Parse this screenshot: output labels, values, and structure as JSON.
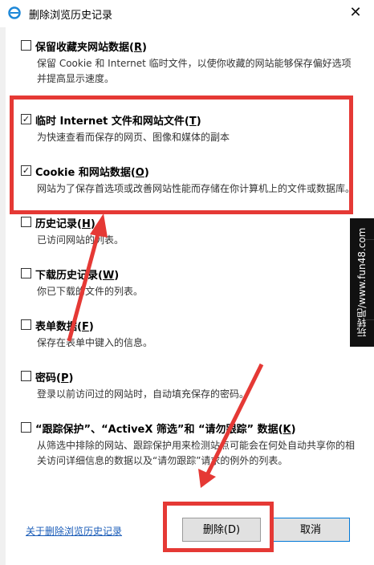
{
  "window": {
    "title": "删除浏览历史记录",
    "close_label": "✕"
  },
  "options": [
    {
      "label": "保留收藏夹网站数据(",
      "key": "R",
      "suffix": ")",
      "checked": false,
      "desc": "保留 Cookie 和 Internet 临时文件，以使你收藏的网站能够保存偏好选项并提高显示速度。"
    },
    {
      "label": "临时 Internet 文件和网站文件(",
      "key": "T",
      "suffix": ")",
      "checked": true,
      "desc": "为快速查看而保存的网页、图像和媒体的副本"
    },
    {
      "label": "Cookie 和网站数据(",
      "key": "O",
      "suffix": ")",
      "checked": true,
      "desc": "网站为了保存首选项或改善网站性能而存储在你计算机上的文件或数据库。"
    },
    {
      "label": "历史记录(",
      "key": "H",
      "suffix": ")",
      "checked": false,
      "desc": "已访问网站的列表。"
    },
    {
      "label": "下载历史记录(",
      "key": "W",
      "suffix": ")",
      "checked": false,
      "desc": "你已下载的文件的列表。"
    },
    {
      "label": "表单数据(",
      "key": "F",
      "suffix": ")",
      "checked": false,
      "desc": "保存在表单中键入的信息。"
    },
    {
      "label": "密码(",
      "key": "P",
      "suffix": ")",
      "checked": false,
      "desc": "登录以前访问过的网站时，自动填充保存的密码。"
    },
    {
      "label": "“跟踪保护”、“ActiveX 筛选”和 “请勿跟踪” 数据(",
      "key": "K",
      "suffix": ")",
      "checked": false,
      "desc": "从筛选中排除的网站、跟踪保护用来检测站点可能会在何处自动共享你的相关访问详细信息的数据以及“请勿跟踪”请求的例外的列表。"
    }
  ],
  "footer": {
    "about_link": "关于删除浏览历史记录",
    "delete_label": "删除(D)",
    "cancel_label": "取消"
  },
  "watermark": {
    "text": "玩转吧/www.fun48.com"
  },
  "colors": {
    "highlight": "#e53935",
    "link": "#1a5cb8"
  }
}
